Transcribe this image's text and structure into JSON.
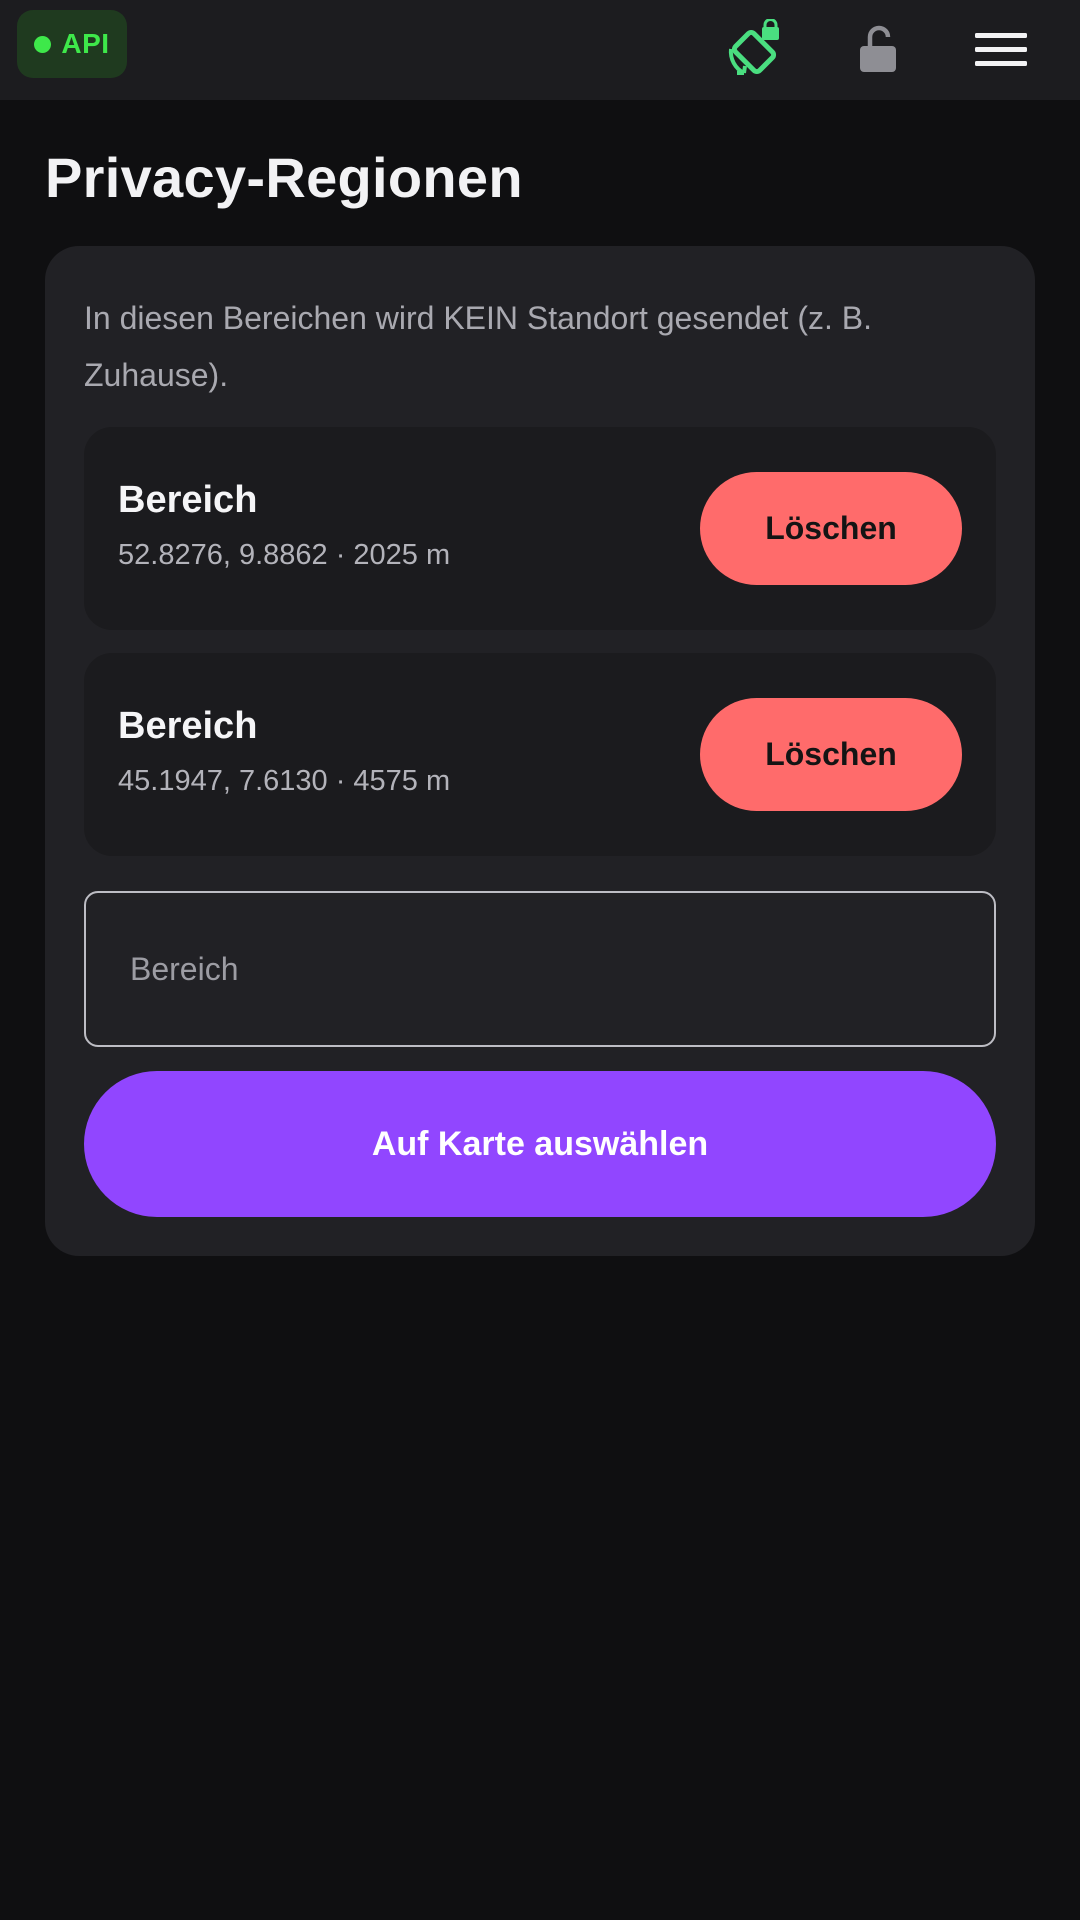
{
  "header": {
    "api_badge": {
      "label": "API",
      "status_color": "#3ee84a"
    },
    "icons": [
      "rotate-lock-icon",
      "unlock-icon",
      "menu-icon"
    ]
  },
  "page": {
    "title": "Privacy-Regionen",
    "description": "In diesen Bereichen wird KEIN Standort gesendet (z. B. Zuhause)."
  },
  "regions": [
    {
      "name": "Bereich",
      "meta": "52.8276, 9.8862 · 2025 m",
      "delete_label": "Löschen"
    },
    {
      "name": "Bereich",
      "meta": "45.1947, 7.6130 · 4575 m",
      "delete_label": "Löschen"
    }
  ],
  "form": {
    "name_placeholder": "Bereich",
    "name_value": "",
    "map_button_label": "Auf Karte auswählen"
  },
  "colors": {
    "accent": "#9146ff",
    "danger": "#ff6b6b",
    "status_ok": "#3ee84a",
    "background": "#0f0f11",
    "card": "#212125"
  }
}
